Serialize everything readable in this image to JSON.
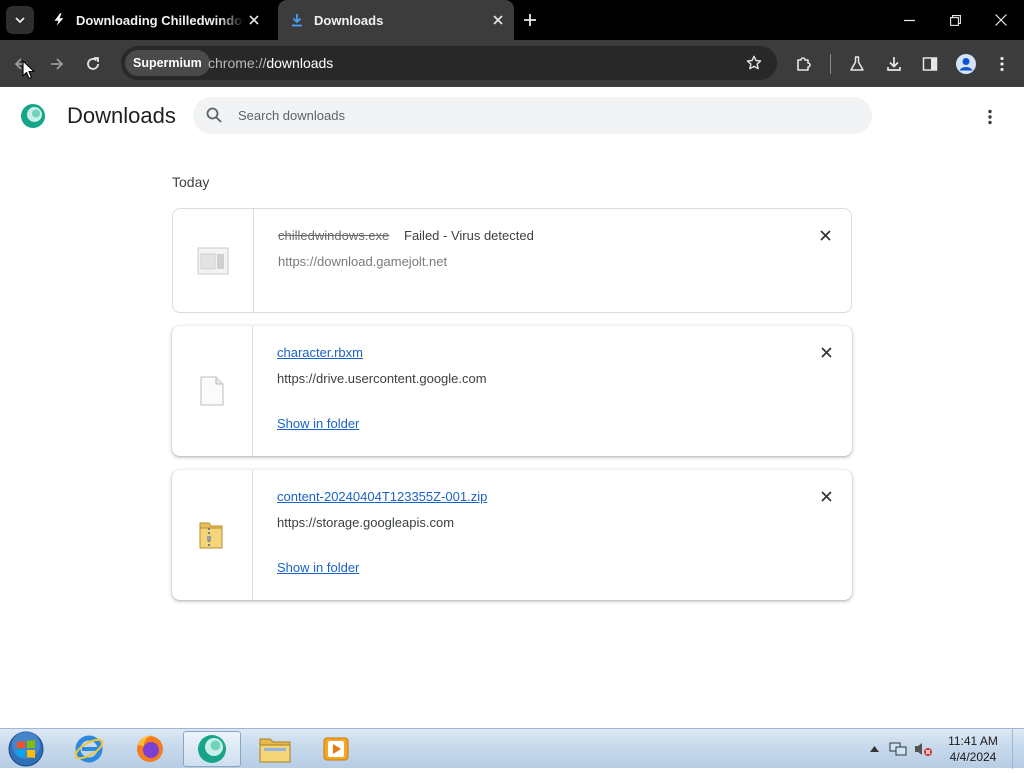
{
  "tabs": [
    {
      "title": "Downloading Chilledwindows.exe",
      "favicon": "lightning-bolt-icon",
      "active": false
    },
    {
      "title": "Downloads",
      "favicon": "download-arrow-icon",
      "active": true
    }
  ],
  "toolbar": {
    "chip": "Supermium",
    "url_scheme": "chrome://",
    "url_path": "downloads"
  },
  "page": {
    "title": "Downloads",
    "search_placeholder": "Search downloads",
    "section_date": "Today"
  },
  "downloads": [
    {
      "file_name": "chilledwindows.exe",
      "status": "Failed - Virus detected",
      "source": "https://download.gamejolt.net",
      "icon": "blocked-file-icon",
      "state": "failed"
    },
    {
      "file_name": "character.rbxm",
      "source": "https://drive.usercontent.google.com",
      "action": "Show in folder",
      "icon": "blank-file-icon",
      "state": "complete"
    },
    {
      "file_name": "content-20240404T123355Z-001.zip",
      "source": "https://storage.googleapis.com",
      "action": "Show in folder",
      "icon": "zip-folder-icon",
      "state": "complete"
    }
  ],
  "taskbar": {
    "apps": [
      "internet-explorer-icon",
      "firefox-icon",
      "supermium-icon",
      "file-explorer-icon",
      "media-player-icon"
    ],
    "time": "11:41 AM",
    "date": "4/4/2024"
  },
  "colors": {
    "tab_bar": "#000000",
    "toolbar": "#3c3c3c",
    "link": "#1a62c9",
    "active_tab_icon": "#4a9df8"
  }
}
